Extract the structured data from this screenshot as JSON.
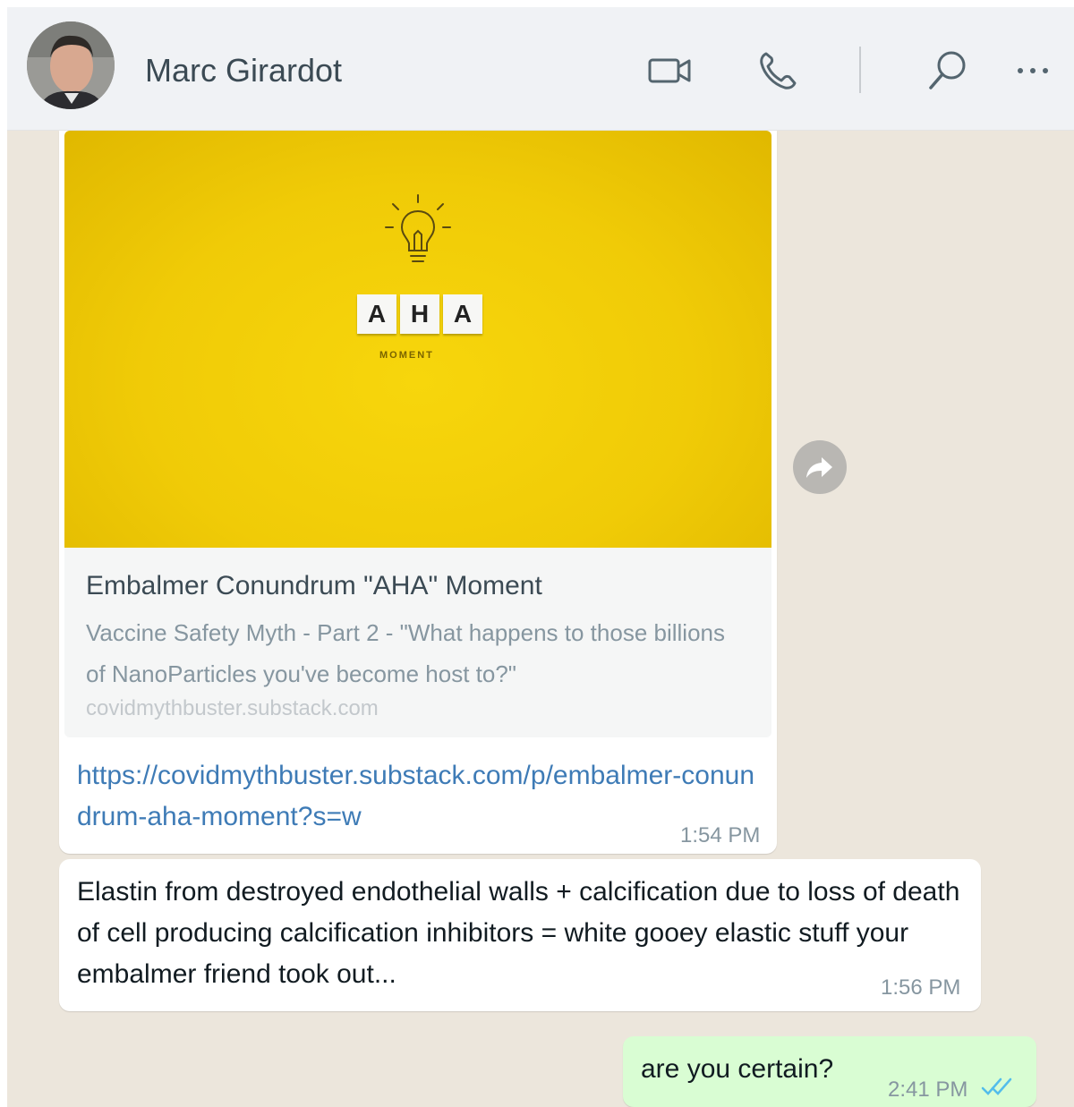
{
  "contact": {
    "name": "Marc Girardot"
  },
  "header_icons": [
    "video-camera-icon",
    "phone-icon",
    "search-icon",
    "more-options-icon"
  ],
  "messages": [
    {
      "type": "link_preview",
      "preview": {
        "tiles": [
          "A",
          "H",
          "A"
        ],
        "tile_caption": "MOMENT",
        "title": "Embalmer Conundrum \"AHA\" Moment",
        "description": "Vaccine Safety Myth - Part 2 - \"What happens to those billions of NanoParticles you've become host to?\"",
        "domain": "covidmythbuster.substack.com"
      },
      "link": "https://covidmythbuster.substack.com/p/embalmer-conundrum-aha-moment?s=w",
      "time": "1:54 PM"
    },
    {
      "type": "text",
      "text": "Elastin from destroyed endothelial walls + calcification due to loss of death of cell producing calcification inhibitors = white gooey elastic stuff your embalmer friend took out...",
      "time": "1:56 PM"
    },
    {
      "type": "outgoing",
      "text": "are you certain?",
      "time": "2:41 PM",
      "status": "read"
    }
  ],
  "colors": {
    "chat_bg": "#ece6dc",
    "outgoing_bubble": "#d9fdd3",
    "link": "#3e7bb6",
    "read_ticks": "#53bdeb",
    "preview_yellow": "#f0cb07"
  }
}
